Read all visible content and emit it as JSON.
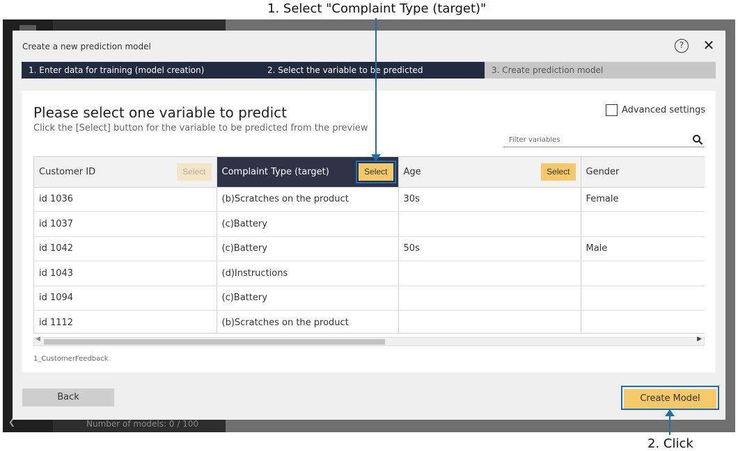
{
  "annotations": {
    "step1": "1. Select \"Complaint Type (target)\"",
    "step2": "2. Click"
  },
  "background": {
    "model_count": "Number of models: 0 / 100"
  },
  "modal": {
    "title": "Create a new prediction model",
    "help_icon": "help-icon",
    "close_icon": "close-icon",
    "steps": [
      {
        "label": "1. Enter data for training (model creation)",
        "state": "done"
      },
      {
        "label": "2. Select the variable to be predicted",
        "state": "active"
      },
      {
        "label": "3. Create prediction model",
        "state": "pending"
      }
    ],
    "heading": "Please select one variable to predict",
    "subheading": "Click the [Select] button for the variable to be predicted from the preview",
    "advanced_settings_label": "Advanced settings",
    "filter": {
      "placeholder": "Filter variables",
      "value": ""
    },
    "table": {
      "columns": [
        {
          "name": "Customer ID",
          "button": "Select",
          "button_state": "disabled"
        },
        {
          "name": "Complaint Type (target)",
          "button": "Select",
          "button_state": "selected"
        },
        {
          "name": "Age",
          "button": "Select",
          "button_state": "enabled"
        },
        {
          "name": "Gender",
          "button": "",
          "button_state": "none"
        }
      ],
      "rows": [
        [
          "id 1036",
          "(b)Scratches on the product",
          "30s",
          "Female"
        ],
        [
          "id 1037",
          "(c)Battery",
          "",
          ""
        ],
        [
          "id 1042",
          "(c)Battery",
          "50s",
          "Male"
        ],
        [
          "id 1043",
          "(d)Instructions",
          "",
          ""
        ],
        [
          "id 1094",
          "(c)Battery",
          "",
          ""
        ],
        [
          "id 1112",
          "(b)Scratches on the product",
          "",
          ""
        ],
        [
          "",
          "",
          "",
          ""
        ]
      ]
    },
    "dataset_name": "1_CustomerFeedback",
    "back_label": "Back",
    "create_label": "Create Model"
  },
  "colors": {
    "accent": "#f5c86a",
    "step_active": "#222a40",
    "selected_header": "#2f3347",
    "highlight": "#1c6fb0"
  }
}
